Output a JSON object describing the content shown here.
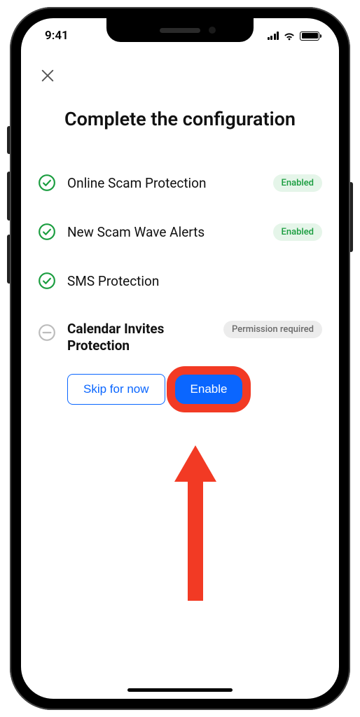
{
  "statusBar": {
    "time": "9:41"
  },
  "title": "Complete the configuration",
  "badges": {
    "enabled": "Enabled",
    "permission": "Permission required"
  },
  "items": [
    {
      "label": "Online Scam Protection",
      "state": "enabled"
    },
    {
      "label": "New Scam Wave Alerts",
      "state": "enabled"
    },
    {
      "label": "SMS Protection",
      "state": "none"
    },
    {
      "label": "Calendar Invites Protection",
      "state": "pending"
    }
  ],
  "actions": {
    "skip": "Skip for now",
    "enable": "Enable"
  }
}
